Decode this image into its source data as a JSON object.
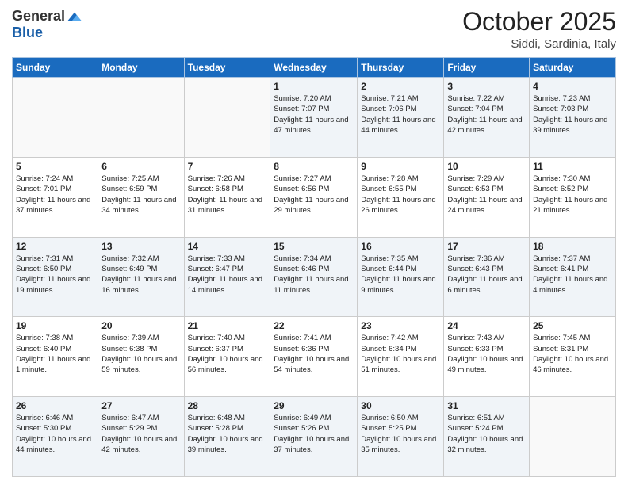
{
  "header": {
    "logo_general": "General",
    "logo_blue": "Blue",
    "month": "October 2025",
    "location": "Siddi, Sardinia, Italy"
  },
  "days_of_week": [
    "Sunday",
    "Monday",
    "Tuesday",
    "Wednesday",
    "Thursday",
    "Friday",
    "Saturday"
  ],
  "weeks": [
    [
      {
        "day": "",
        "info": ""
      },
      {
        "day": "",
        "info": ""
      },
      {
        "day": "",
        "info": ""
      },
      {
        "day": "1",
        "info": "Sunrise: 7:20 AM\nSunset: 7:07 PM\nDaylight: 11 hours and 47 minutes."
      },
      {
        "day": "2",
        "info": "Sunrise: 7:21 AM\nSunset: 7:06 PM\nDaylight: 11 hours and 44 minutes."
      },
      {
        "day": "3",
        "info": "Sunrise: 7:22 AM\nSunset: 7:04 PM\nDaylight: 11 hours and 42 minutes."
      },
      {
        "day": "4",
        "info": "Sunrise: 7:23 AM\nSunset: 7:03 PM\nDaylight: 11 hours and 39 minutes."
      }
    ],
    [
      {
        "day": "5",
        "info": "Sunrise: 7:24 AM\nSunset: 7:01 PM\nDaylight: 11 hours and 37 minutes."
      },
      {
        "day": "6",
        "info": "Sunrise: 7:25 AM\nSunset: 6:59 PM\nDaylight: 11 hours and 34 minutes."
      },
      {
        "day": "7",
        "info": "Sunrise: 7:26 AM\nSunset: 6:58 PM\nDaylight: 11 hours and 31 minutes."
      },
      {
        "day": "8",
        "info": "Sunrise: 7:27 AM\nSunset: 6:56 PM\nDaylight: 11 hours and 29 minutes."
      },
      {
        "day": "9",
        "info": "Sunrise: 7:28 AM\nSunset: 6:55 PM\nDaylight: 11 hours and 26 minutes."
      },
      {
        "day": "10",
        "info": "Sunrise: 7:29 AM\nSunset: 6:53 PM\nDaylight: 11 hours and 24 minutes."
      },
      {
        "day": "11",
        "info": "Sunrise: 7:30 AM\nSunset: 6:52 PM\nDaylight: 11 hours and 21 minutes."
      }
    ],
    [
      {
        "day": "12",
        "info": "Sunrise: 7:31 AM\nSunset: 6:50 PM\nDaylight: 11 hours and 19 minutes."
      },
      {
        "day": "13",
        "info": "Sunrise: 7:32 AM\nSunset: 6:49 PM\nDaylight: 11 hours and 16 minutes."
      },
      {
        "day": "14",
        "info": "Sunrise: 7:33 AM\nSunset: 6:47 PM\nDaylight: 11 hours and 14 minutes."
      },
      {
        "day": "15",
        "info": "Sunrise: 7:34 AM\nSunset: 6:46 PM\nDaylight: 11 hours and 11 minutes."
      },
      {
        "day": "16",
        "info": "Sunrise: 7:35 AM\nSunset: 6:44 PM\nDaylight: 11 hours and 9 minutes."
      },
      {
        "day": "17",
        "info": "Sunrise: 7:36 AM\nSunset: 6:43 PM\nDaylight: 11 hours and 6 minutes."
      },
      {
        "day": "18",
        "info": "Sunrise: 7:37 AM\nSunset: 6:41 PM\nDaylight: 11 hours and 4 minutes."
      }
    ],
    [
      {
        "day": "19",
        "info": "Sunrise: 7:38 AM\nSunset: 6:40 PM\nDaylight: 11 hours and 1 minute."
      },
      {
        "day": "20",
        "info": "Sunrise: 7:39 AM\nSunset: 6:38 PM\nDaylight: 10 hours and 59 minutes."
      },
      {
        "day": "21",
        "info": "Sunrise: 7:40 AM\nSunset: 6:37 PM\nDaylight: 10 hours and 56 minutes."
      },
      {
        "day": "22",
        "info": "Sunrise: 7:41 AM\nSunset: 6:36 PM\nDaylight: 10 hours and 54 minutes."
      },
      {
        "day": "23",
        "info": "Sunrise: 7:42 AM\nSunset: 6:34 PM\nDaylight: 10 hours and 51 minutes."
      },
      {
        "day": "24",
        "info": "Sunrise: 7:43 AM\nSunset: 6:33 PM\nDaylight: 10 hours and 49 minutes."
      },
      {
        "day": "25",
        "info": "Sunrise: 7:45 AM\nSunset: 6:31 PM\nDaylight: 10 hours and 46 minutes."
      }
    ],
    [
      {
        "day": "26",
        "info": "Sunrise: 6:46 AM\nSunset: 5:30 PM\nDaylight: 10 hours and 44 minutes."
      },
      {
        "day": "27",
        "info": "Sunrise: 6:47 AM\nSunset: 5:29 PM\nDaylight: 10 hours and 42 minutes."
      },
      {
        "day": "28",
        "info": "Sunrise: 6:48 AM\nSunset: 5:28 PM\nDaylight: 10 hours and 39 minutes."
      },
      {
        "day": "29",
        "info": "Sunrise: 6:49 AM\nSunset: 5:26 PM\nDaylight: 10 hours and 37 minutes."
      },
      {
        "day": "30",
        "info": "Sunrise: 6:50 AM\nSunset: 5:25 PM\nDaylight: 10 hours and 35 minutes."
      },
      {
        "day": "31",
        "info": "Sunrise: 6:51 AM\nSunset: 5:24 PM\nDaylight: 10 hours and 32 minutes."
      },
      {
        "day": "",
        "info": ""
      }
    ]
  ]
}
